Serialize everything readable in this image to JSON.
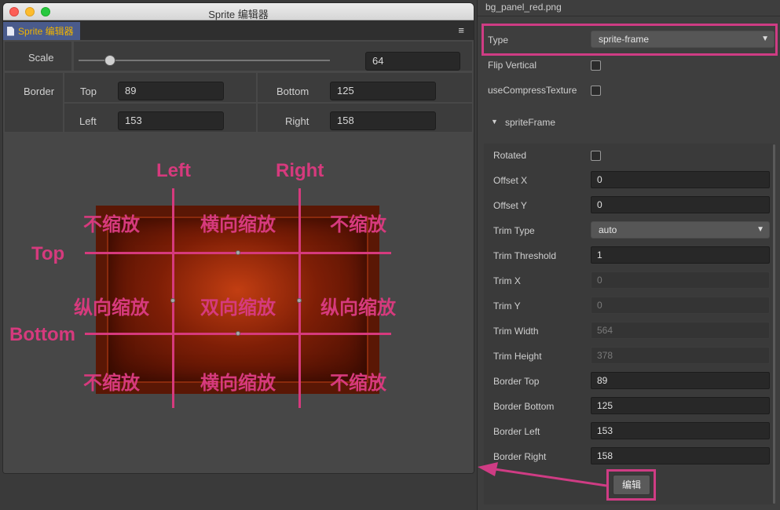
{
  "window": {
    "title": "Sprite 编辑器",
    "tab_label": "Sprite 编辑器",
    "menu_icon": "hamburger-icon"
  },
  "props": {
    "scale_label": "Scale",
    "scale_value": "64",
    "border_label": "Border",
    "top_label": "Top",
    "top_value": "89",
    "bottom_label": "Bottom",
    "bottom_value": "125",
    "left_label": "Left",
    "left_value": "153",
    "right_label": "Right",
    "right_value": "158"
  },
  "canvas": {
    "edge_left": "Left",
    "edge_right": "Right",
    "edge_top": "Top",
    "edge_bottom": "Bottom",
    "zones": [
      "不缩放",
      "横向缩放",
      "不缩放",
      "纵向缩放",
      "双向缩放",
      "纵向缩放",
      "不缩放",
      "横向缩放",
      "不缩放"
    ],
    "guide_color": "#d63a7d"
  },
  "inspector": {
    "file_name": "bg_panel_red.png",
    "type_label": "Type",
    "type_value": "sprite-frame",
    "flip_vertical_label": "Flip Vertical",
    "compress_label": "useCompressTexture",
    "sprite_frame_label": "spriteFrame",
    "rotated_label": "Rotated",
    "offset_x_label": "Offset X",
    "offset_x_value": "0",
    "offset_y_label": "Offset Y",
    "offset_y_value": "0",
    "trim_type_label": "Trim Type",
    "trim_type_value": "auto",
    "trim_threshold_label": "Trim Threshold",
    "trim_threshold_value": "1",
    "trim_x_label": "Trim X",
    "trim_x_value": "0",
    "trim_y_label": "Trim Y",
    "trim_y_value": "0",
    "trim_width_label": "Trim Width",
    "trim_width_value": "564",
    "trim_height_label": "Trim Height",
    "trim_height_value": "378",
    "border_top_label": "Border Top",
    "border_top_value": "89",
    "border_bottom_label": "Border Bottom",
    "border_bottom_value": "125",
    "border_left_label": "Border Left",
    "border_left_value": "153",
    "border_right_label": "Border Right",
    "border_right_value": "158",
    "edit_button": "编辑"
  },
  "colors": {
    "highlight": "#cf3c84",
    "tab_bg": "#4a5b8c",
    "tab_text": "#f0b400"
  }
}
